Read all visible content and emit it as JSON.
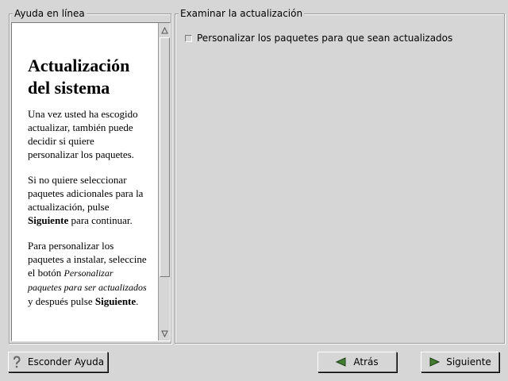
{
  "help_panel": {
    "legend": "Ayuda en línea",
    "title": "Actualización del sistema",
    "paragraph1": "Una vez usted ha escogido actualizar, también puede decidir si quiere personalizar los paquetes.",
    "paragraph2_pre": "Si no quiere seleccionar paquetes adicionales para la actualización, pulse ",
    "paragraph2_bold": "Siguiente",
    "paragraph2_post": " para continuar.",
    "paragraph3_pre": "Para personalizar los paquetes a instalar, seleccine el botón ",
    "paragraph3_italic": "Personalizar paquetes para ser actualizados",
    "paragraph3_mid": " y después pulse ",
    "paragraph3_bold": "Siguiente",
    "paragraph3_post": "."
  },
  "upgrade_panel": {
    "legend": "Examinar la actualización",
    "checkbox_label": "Personalizar los paquetes para que sean actualizados",
    "checkbox_checked": false
  },
  "buttons": {
    "hide_help": "Esconder Ayuda",
    "back": "Atrás",
    "next": "Siguiente"
  },
  "icons": {
    "help": "question-mark-icon",
    "back": "arrow-left-icon",
    "next": "arrow-right-icon"
  },
  "colors": {
    "background": "#d6d6d6",
    "help_bg": "#ffffff",
    "arrow_green": "#3f7f2f"
  }
}
